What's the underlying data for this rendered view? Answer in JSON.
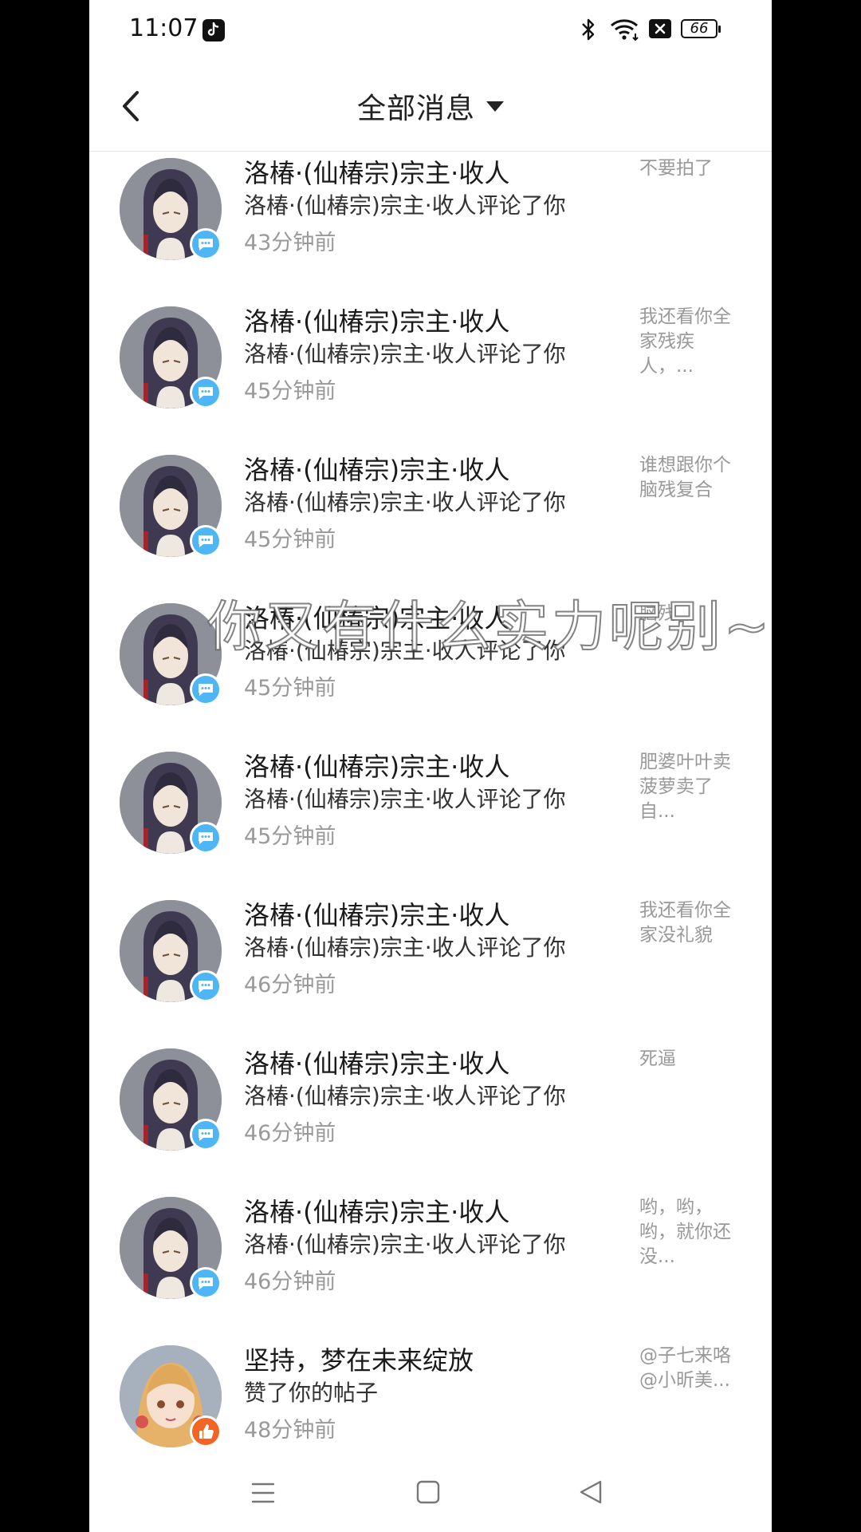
{
  "status_bar": {
    "time": "11:07",
    "battery": "66"
  },
  "header": {
    "title": "全部消息"
  },
  "messages": [
    {
      "name": "洛椿·(仙椿宗)宗主·收人",
      "action": "洛椿·(仙椿宗)宗主·收人评论了你",
      "time": "43分钟前",
      "preview": "不要拍了",
      "badge": "comment"
    },
    {
      "name": "洛椿·(仙椿宗)宗主·收人",
      "action": "洛椿·(仙椿宗)宗主·收人评论了你",
      "time": "45分钟前",
      "preview": "我还看你全家残疾人，...",
      "badge": "comment"
    },
    {
      "name": "洛椿·(仙椿宗)宗主·收人",
      "action": "洛椿·(仙椿宗)宗主·收人评论了你",
      "time": "45分钟前",
      "preview": "谁想跟你个脑残复合",
      "badge": "comment"
    },
    {
      "name": "洛椿·(仙椿宗)宗主·收人",
      "action": "洛椿·(仙椿宗)宗主·收人评论了你",
      "time": "45分钟前",
      "preview": "脑残",
      "badge": "comment"
    },
    {
      "name": "洛椿·(仙椿宗)宗主·收人",
      "action": "洛椿·(仙椿宗)宗主·收人评论了你",
      "time": "45分钟前",
      "preview": "肥婆叶叶卖菠萝卖了自...",
      "badge": "comment"
    },
    {
      "name": "洛椿·(仙椿宗)宗主·收人",
      "action": "洛椿·(仙椿宗)宗主·收人评论了你",
      "time": "46分钟前",
      "preview": "我还看你全家没礼貌",
      "badge": "comment"
    },
    {
      "name": "洛椿·(仙椿宗)宗主·收人",
      "action": "洛椿·(仙椿宗)宗主·收人评论了你",
      "time": "46分钟前",
      "preview": "死逼",
      "badge": "comment"
    },
    {
      "name": "洛椿·(仙椿宗)宗主·收人",
      "action": "洛椿·(仙椿宗)宗主·收人评论了你",
      "time": "46分钟前",
      "preview": "哟，哟，哟，就你还没...",
      "badge": "comment"
    },
    {
      "name": "坚持，梦在未来绽放",
      "action": "赞了你的帖子",
      "time": "48分钟前",
      "preview": "@子七来咯@小昕美...",
      "badge": "like"
    }
  ],
  "overlay": {
    "caption": "你又有什么实力呢别~叫"
  },
  "colors": {
    "comment_badge": "#4fb6f5",
    "like_badge": "#f26522",
    "muted_text": "#999999"
  }
}
